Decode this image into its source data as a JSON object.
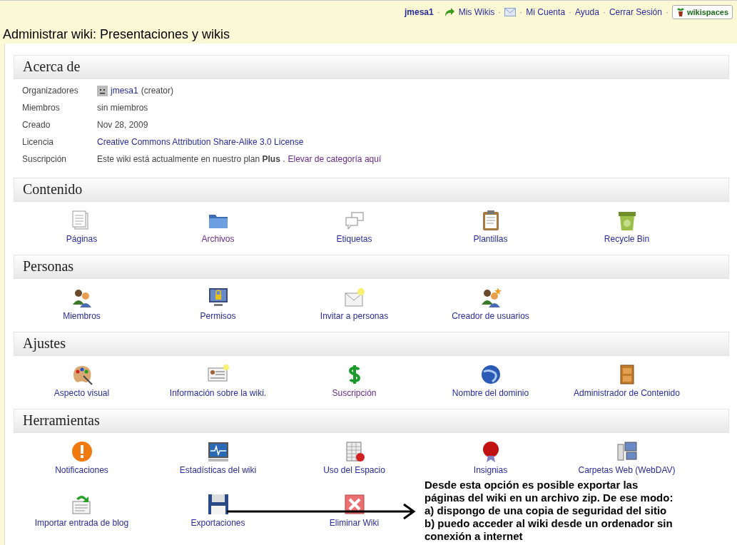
{
  "top_bar": {
    "items": [
      {
        "kind": "user",
        "text": "jmesa1"
      },
      {
        "kind": "sep",
        "text": "·"
      },
      {
        "kind": "link-arrow",
        "text": "Mis Wikis"
      },
      {
        "kind": "sep",
        "text": "·"
      },
      {
        "kind": "mail"
      },
      {
        "kind": "sep",
        "text": "·"
      },
      {
        "kind": "link",
        "text": "Mi Cuenta"
      },
      {
        "kind": "sep",
        "text": "·"
      },
      {
        "kind": "link",
        "text": "Ayuda"
      },
      {
        "kind": "sep",
        "text": "·"
      },
      {
        "kind": "link",
        "text": "Cerrar Sesión"
      },
      {
        "kind": "sep",
        "text": "·"
      }
    ],
    "logo": "wikispaces"
  },
  "title": "Administrar wiki: Presentaciones y wikis",
  "about": {
    "heading": "Acerca de",
    "rows": [
      {
        "label": "Organizadores",
        "parts": [
          {
            "kind": "avatar"
          },
          {
            "kind": "link",
            "text": "jmesa1"
          },
          {
            "kind": "text",
            "text": "(creator)"
          }
        ]
      },
      {
        "label": "Miembros",
        "parts": [
          {
            "kind": "text",
            "text": "sin miembros"
          }
        ]
      },
      {
        "label": "Creado",
        "parts": [
          {
            "kind": "text",
            "text": "Nov 28, 2009"
          }
        ]
      },
      {
        "label": "Licencia",
        "parts": [
          {
            "kind": "link",
            "text": "Creative Commons Attribution Share-Alike 3.0 License"
          }
        ]
      },
      {
        "label": "Suscripción",
        "parts": [
          {
            "kind": "text",
            "text": "Este wiki está actualmente en nuestro plan **Plus** ."
          },
          {
            "kind": "visited",
            "text": "Elevar de categoría aquí"
          }
        ]
      }
    ]
  },
  "sections": [
    {
      "heading": "Contenido",
      "items": [
        {
          "label": "Páginas"
        },
        {
          "label": "Archivos",
          "visited": true
        },
        {
          "label": "Etiquetas"
        },
        {
          "label": "Plantillas"
        },
        {
          "label": "Recycle Bin"
        }
      ]
    },
    {
      "heading": "Personas",
      "items": [
        {
          "label": "Miembros"
        },
        {
          "label": "Permisos"
        },
        {
          "label": "Invitar a personas"
        },
        {
          "label": "Creador de usuarios"
        }
      ]
    },
    {
      "heading": "Ajustes",
      "items": [
        {
          "label": "Aspecto visual"
        },
        {
          "label": "Información sobre la wiki."
        },
        {
          "label": "Suscripción",
          "visited": true
        },
        {
          "label": "Nombre del dominio"
        },
        {
          "label": "Administrador de Contenido"
        }
      ]
    },
    {
      "heading": "Herramientas",
      "items": [
        {
          "label": "Notificaciones"
        },
        {
          "label": "Estadísticas del wiki"
        },
        {
          "label": "Uso del Espacio"
        },
        {
          "label": "Insignias"
        },
        {
          "label": "Carpetas Web (WebDAV)"
        },
        {
          "label": "Importar entrada de blog"
        },
        {
          "label": "Exportaciones"
        },
        {
          "label": "Eliminar Wiki"
        }
      ]
    }
  ],
  "annotation": {
    "lines": [
      "Desde esta opción es posible exportar las",
      "páginas del wiki en un archivo zip. De ese modo:",
      "a) dispongo de una copia de seguridad del sitio",
      "b) puedo acceder al wiki desde un ordenador sin",
      "conexión a internet"
    ]
  }
}
